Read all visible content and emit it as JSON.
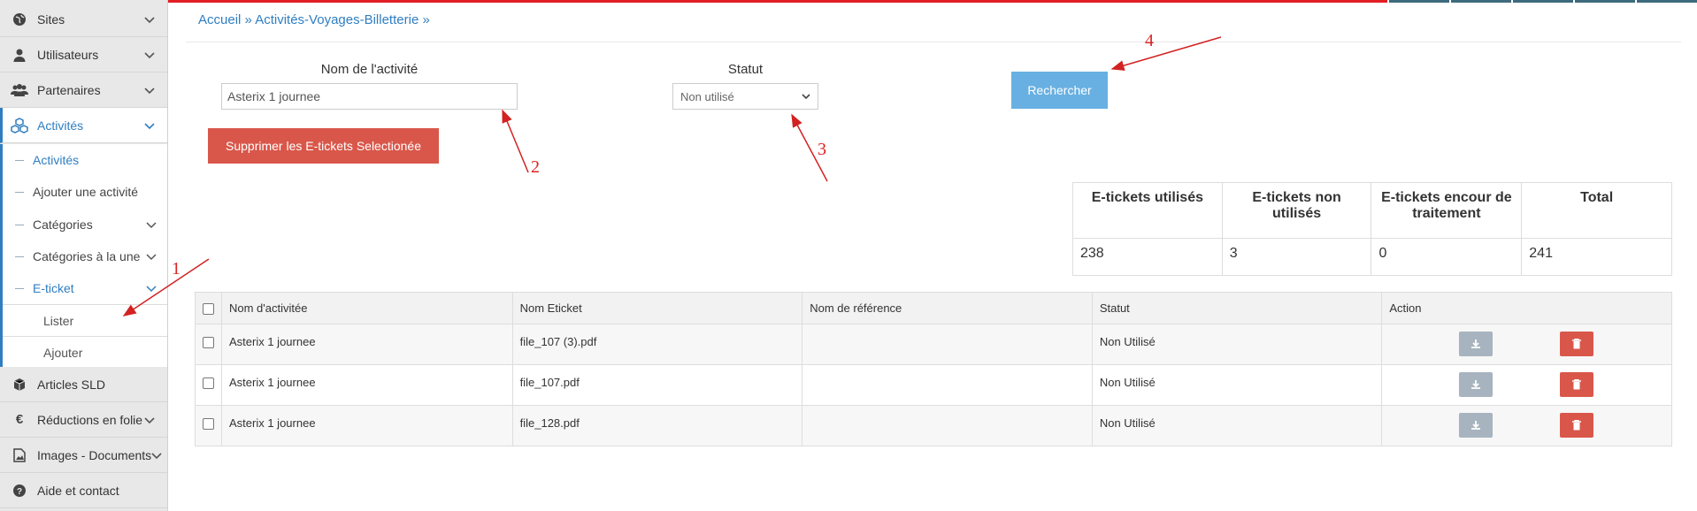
{
  "sidebar": {
    "items": [
      {
        "label": "Sites",
        "icon": "globe-icon"
      },
      {
        "label": "Utilisateurs",
        "icon": "user-icon"
      },
      {
        "label": "Partenaires",
        "icon": "users-icon"
      },
      {
        "label": "Activités",
        "icon": "cubes-icon"
      },
      {
        "label": "Articles SLD",
        "icon": "cube-icon"
      },
      {
        "label": "Réductions en folie",
        "icon": "euro-icon"
      },
      {
        "label": "Images - Documents",
        "icon": "image-file-icon"
      },
      {
        "label": "Aide et contact",
        "icon": "question-icon"
      }
    ],
    "submenu": [
      {
        "label": "Activités"
      },
      {
        "label": "Ajouter une activité"
      },
      {
        "label": "Catégories"
      },
      {
        "label": "Catégories à la une"
      },
      {
        "label": "E-ticket"
      }
    ],
    "eticket_submenu": [
      {
        "label": "Lister"
      },
      {
        "label": "Ajouter"
      }
    ]
  },
  "breadcrumb": "Accueil » Activités-Voyages-Billetterie »",
  "filters": {
    "name_label": "Nom de l'activité",
    "name_value": "Asterix 1 journee",
    "status_label": "Statut",
    "status_value": "Non utilisé",
    "search_label": "Rechercher"
  },
  "delete_label": "Supprimer les E-tickets Selectionée",
  "stats": {
    "headers": [
      "E-tickets utilisés",
      "E-tickets non utilisés",
      "E-tickets encour de traitement",
      "Total"
    ],
    "values": [
      "238",
      "3",
      "0",
      "241"
    ]
  },
  "table": {
    "headers": [
      "Nom d'activitée",
      "Nom Eticket",
      "Nom de référence",
      "Statut",
      "Action"
    ],
    "rows": [
      {
        "activity": "Asterix 1 journee",
        "eticket": "file_107 (3).pdf",
        "reference": "",
        "status": "Non Utilisé"
      },
      {
        "activity": "Asterix 1 journee",
        "eticket": "file_107.pdf",
        "reference": "",
        "status": "Non Utilisé"
      },
      {
        "activity": "Asterix 1 journee",
        "eticket": "file_128.pdf",
        "reference": "",
        "status": "Non Utilisé"
      }
    ]
  },
  "annotations": [
    "1",
    "2",
    "3",
    "4"
  ],
  "colors": {
    "accent": "#2f7ec1",
    "danger": "#d9574a",
    "search": "#68b0e2",
    "annotation": "#d22222",
    "topbar": "#e31e24"
  }
}
